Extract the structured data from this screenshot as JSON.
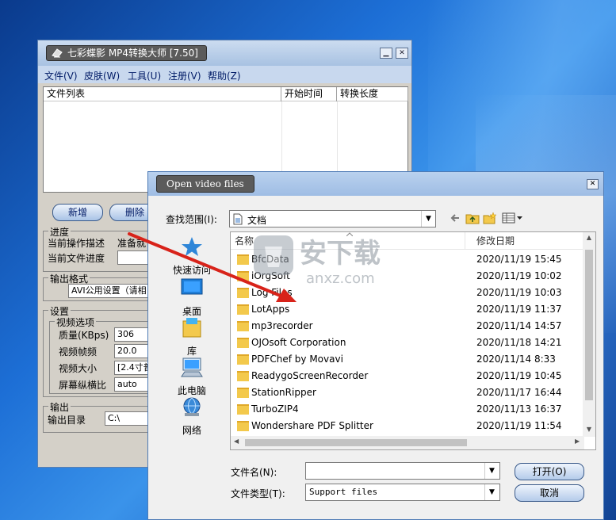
{
  "main_window": {
    "title": "七彩蝶影 MP4转换大师 [7.50]",
    "menu": [
      "文件(V)",
      "皮肤(W)",
      "工具(U)",
      "注册(V)",
      "帮助(Z)"
    ],
    "filelist_columns": [
      "文件列表",
      "开始时间",
      "转换长度"
    ],
    "buttons": {
      "add": "新增",
      "delete": "删除"
    },
    "progress": {
      "group": "进度",
      "current_op_label": "当前操作描述",
      "current_op_value": "准备就",
      "current_file_label": "当前文件进度"
    },
    "output_format": {
      "group": "输出格式",
      "value": "AVI公用设置（请相"
    },
    "settings": {
      "group": "设置",
      "video_group": "视频选项",
      "rows": [
        {
          "label": "质量(KBps)",
          "value": "306"
        },
        {
          "label": "视频帧频",
          "value": "20.0"
        },
        {
          "label": "视频大小",
          "value": "[2.4寸普"
        },
        {
          "label": "屏幕纵横比",
          "value": "auto"
        }
      ]
    },
    "output": {
      "group": "输出",
      "dir_label": "输出目录",
      "dir_value": "C:\\"
    }
  },
  "dialog": {
    "title": "Open video files",
    "lookin_label": "查找范围(I):",
    "lookin_value": "文档",
    "places": [
      "快速访问",
      "桌面",
      "库",
      "此电脑",
      "网络"
    ],
    "columns": {
      "name": "名称",
      "date": "修改日期"
    },
    "files": [
      {
        "name": "BfcData",
        "date": "2020/11/19 15:45"
      },
      {
        "name": "iOrgSoft",
        "date": "2020/11/19 10:02"
      },
      {
        "name": "Log Files",
        "date": "2020/11/19 10:03"
      },
      {
        "name": "LotApps",
        "date": "2020/11/19 11:37"
      },
      {
        "name": "mp3recorder",
        "date": "2020/11/14 14:57"
      },
      {
        "name": "OJOsoft Corporation",
        "date": "2020/11/18 14:21"
      },
      {
        "name": "PDFChef by Movavi",
        "date": "2020/11/14 8:33"
      },
      {
        "name": "ReadygoScreenRecorder",
        "date": "2020/11/19 10:45"
      },
      {
        "name": "StationRipper",
        "date": "2020/11/17 16:44"
      },
      {
        "name": "TurboZIP4",
        "date": "2020/11/13 16:37"
      },
      {
        "name": "Wondershare PDF Splitter",
        "date": "2020/11/19 11:54"
      }
    ],
    "filename_label": "文件名(N):",
    "filename_value": "",
    "filetype_label": "文件类型(T):",
    "filetype_value": "Support files",
    "open_button": "打开(O)",
    "cancel_button": "取消"
  },
  "watermark": {
    "cn": "安下载",
    "en": "anxz.com"
  },
  "colors": {
    "arrow": "#d8231a",
    "folder": "#f3c94c",
    "accent": "#3a5a8a"
  }
}
